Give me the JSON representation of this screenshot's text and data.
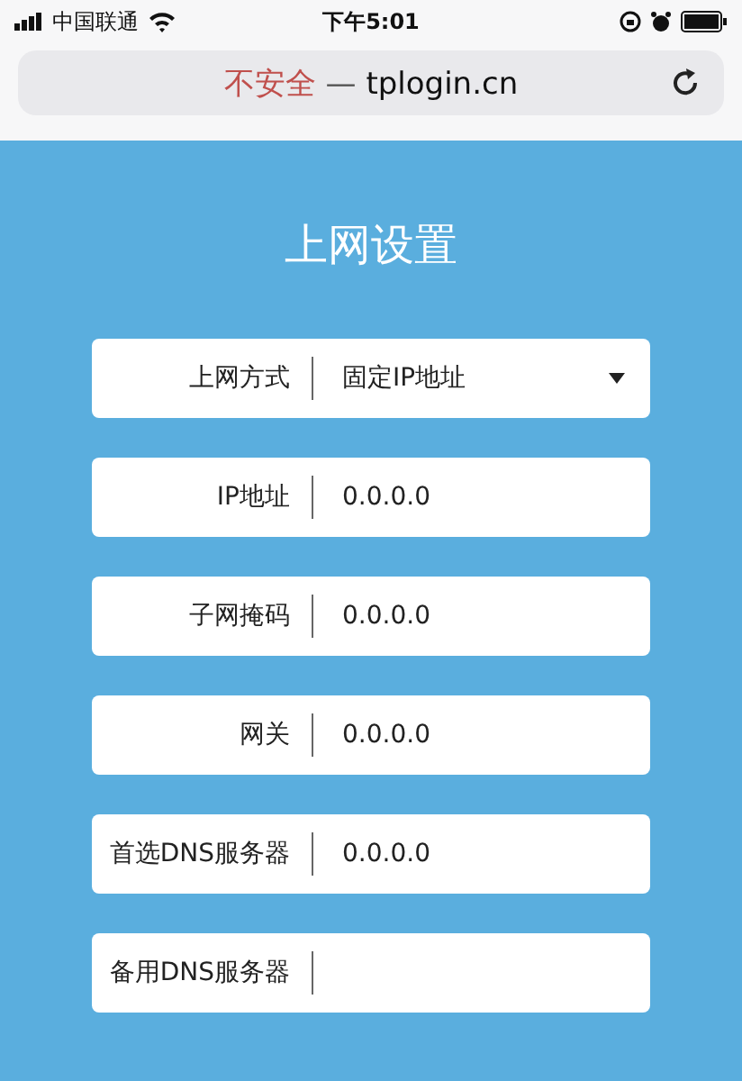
{
  "status_bar": {
    "carrier": "中国联通",
    "time": "下午5:01"
  },
  "address_bar": {
    "security": "不安全",
    "separator": "—",
    "url": "tplogin.cn"
  },
  "page": {
    "title": "上网设置",
    "fields": [
      {
        "label": "上网方式",
        "kind": "select",
        "value": "固定IP地址"
      },
      {
        "label": "IP地址",
        "kind": "input",
        "value": "0.0.0.0"
      },
      {
        "label": "子网掩码",
        "kind": "input",
        "value": "0.0.0.0"
      },
      {
        "label": "网关",
        "kind": "input",
        "value": "0.0.0.0"
      },
      {
        "label": "首选DNS服务器",
        "kind": "input",
        "value": "0.0.0.0"
      },
      {
        "label": "备用DNS服务器",
        "kind": "input"
      }
    ]
  }
}
